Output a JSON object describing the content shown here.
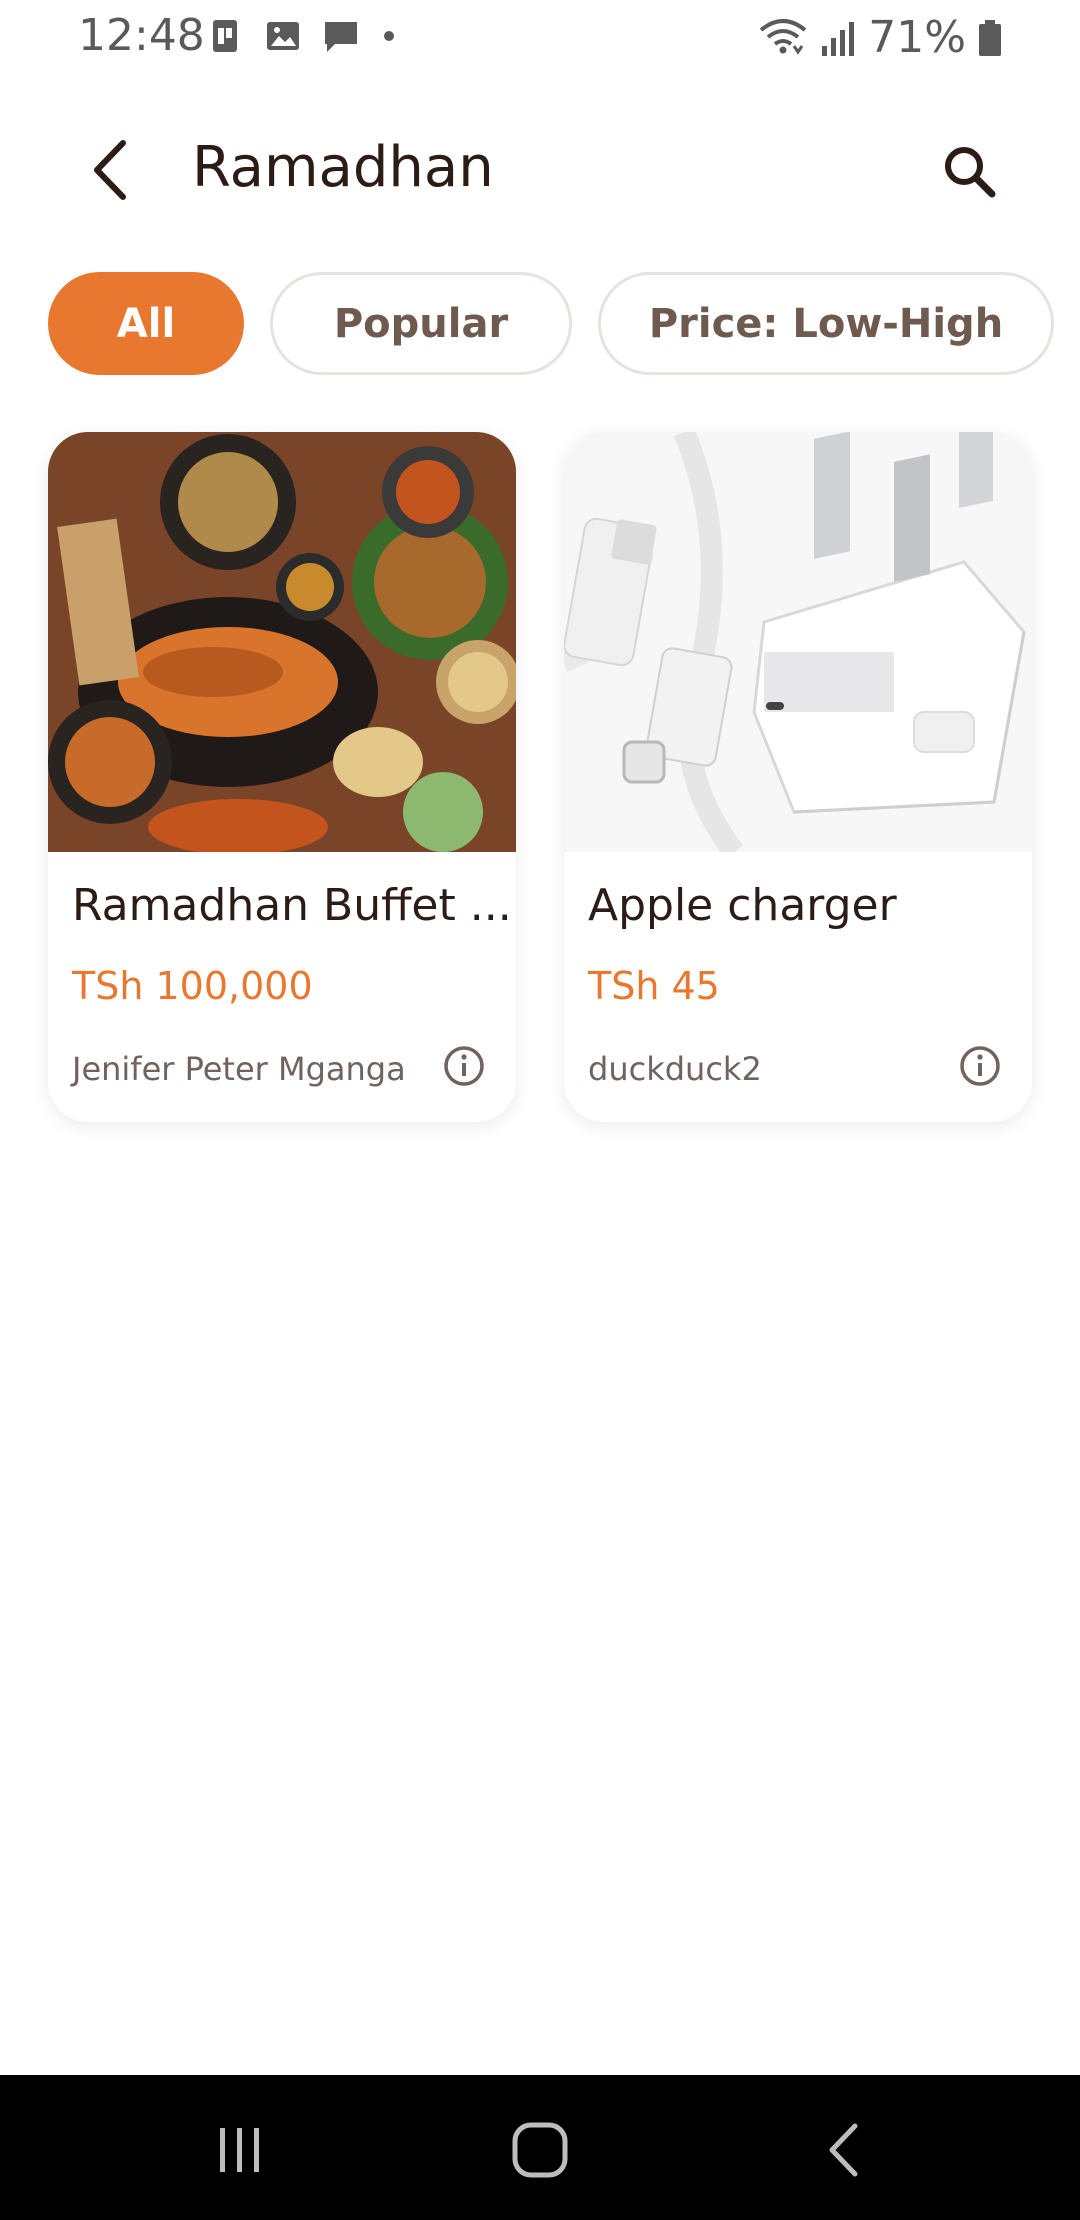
{
  "status_bar": {
    "time": "12:48",
    "battery": "71%",
    "icons": [
      "sim-icon",
      "gallery-icon",
      "message-icon",
      "dot-icon",
      "wifi-icon",
      "signal-icon",
      "battery-icon"
    ]
  },
  "header": {
    "title": "Ramadhan",
    "back_icon": "back-arrow-icon",
    "search_icon": "search-icon"
  },
  "filters": [
    {
      "label": "All",
      "active": true
    },
    {
      "label": "Popular",
      "active": false
    },
    {
      "label": "Price: Low-High",
      "active": false
    }
  ],
  "products": [
    {
      "title": "Ramadhan Buffet ...",
      "price": "TSh 100,000",
      "seller": "Jenifer Peter Mganga",
      "image": "food-buffet-photo"
    },
    {
      "title": "Apple charger",
      "price": "TSh 45",
      "seller": "duckduck2",
      "image": "charger-photo"
    }
  ],
  "colors": {
    "accent": "#e8782f",
    "title": "#2b1c16",
    "chip_text": "#6f5a50"
  },
  "nav_bar": {
    "recents_icon": "recents-icon",
    "home_icon": "home-icon",
    "back_icon": "nav-back-icon"
  }
}
